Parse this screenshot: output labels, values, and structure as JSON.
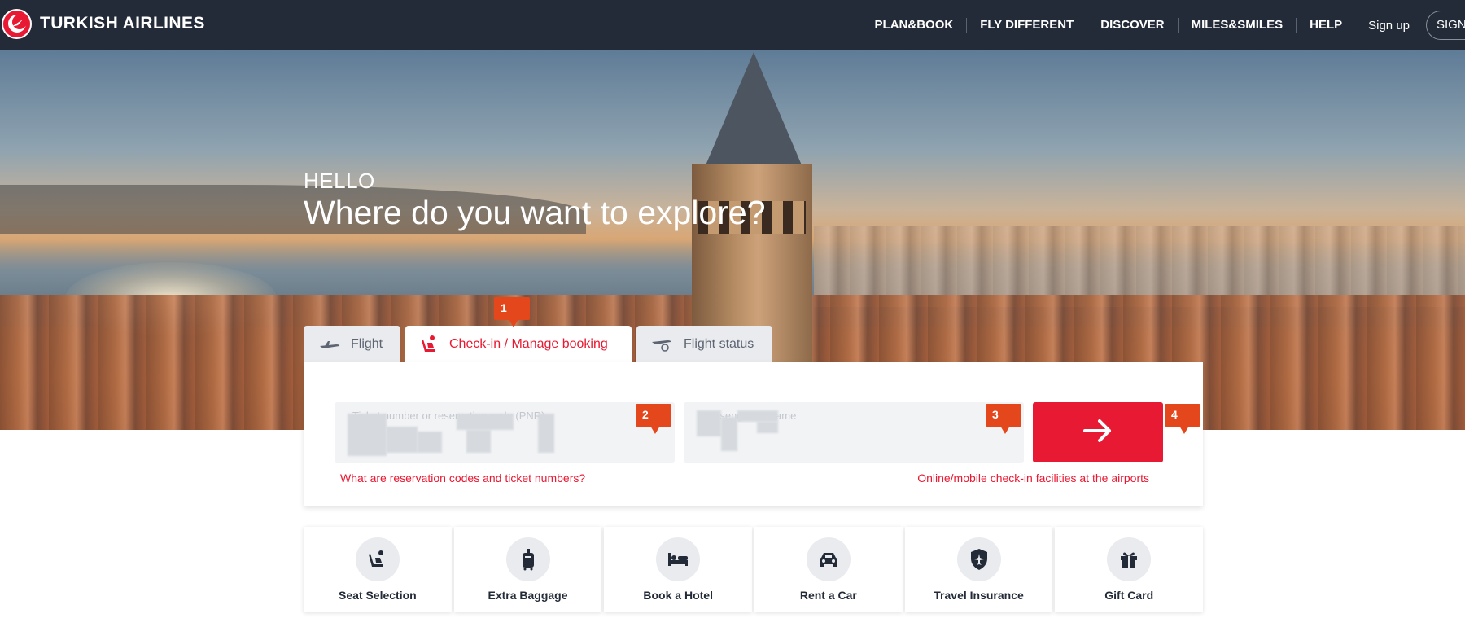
{
  "brand": {
    "name": "TURKISH AIRLINES",
    "logo_icon": "crescent-bird-logo",
    "accent": "#e81932",
    "header_bg": "#232b38"
  },
  "nav": {
    "items": [
      "PLAN&BOOK",
      "FLY DIFFERENT",
      "DISCOVER",
      "MILES&SMILES",
      "HELP"
    ],
    "signup": "Sign up",
    "signin": "SIGN"
  },
  "hero": {
    "greeting": "HELLO",
    "headline": "Where do you want to explore?"
  },
  "tabs": [
    {
      "label": "Flight",
      "icon": "airplane-takeoff-icon",
      "active": false
    },
    {
      "label": "Check-in / Manage booking",
      "icon": "seat-person-icon",
      "active": true
    },
    {
      "label": "Flight status",
      "icon": "flight-status-icon",
      "active": false
    }
  ],
  "form": {
    "pnr_label": "Ticket number or reservation code (PNR)",
    "surname_label": "Passenger surname",
    "submit_icon": "arrow-right-icon",
    "help_left": "What are reservation codes and ticket numbers?",
    "help_right": "Online/mobile check-in facilities at the airports"
  },
  "markers": [
    "1",
    "2",
    "3",
    "4"
  ],
  "services": [
    {
      "label": "Seat Selection",
      "icon": "seat-icon"
    },
    {
      "label": "Extra Baggage",
      "icon": "baggage-icon"
    },
    {
      "label": "Book a Hotel",
      "icon": "bed-icon"
    },
    {
      "label": "Rent a Car",
      "icon": "car-icon"
    },
    {
      "label": "Travel Insurance",
      "icon": "shield-plane-icon"
    },
    {
      "label": "Gift Card",
      "icon": "gift-icon"
    }
  ]
}
